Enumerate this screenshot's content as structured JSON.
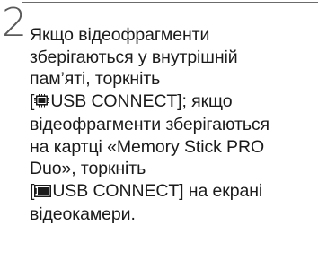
{
  "step": {
    "number": "2",
    "lines": [
      "Якщо відеофрагменти",
      "зберігаються у внутрішній",
      "пам’яті, торкніть",
      "",
      "відеофрагменти зберігаються",
      "на картці «Memory Stick PRO",
      "Duo», торкніть",
      "",
      "відеокамери."
    ],
    "button_internal": {
      "open": "[",
      "icon": "internal-memory-icon",
      "label": "USB CONNECT",
      "tail": "]; якщо"
    },
    "button_card": {
      "open": "[",
      "icon": "memory-card-icon",
      "label": "USB CONNECT",
      "tail": "] на екрані"
    }
  }
}
